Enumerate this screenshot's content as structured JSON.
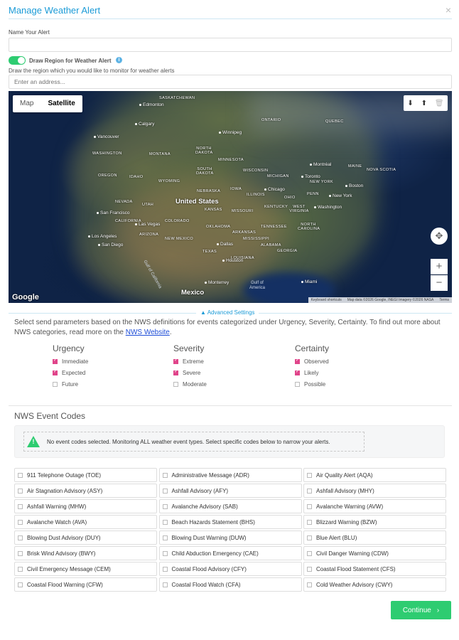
{
  "header": {
    "title": "Manage Weather Alert",
    "close_glyph": "×"
  },
  "name_field": {
    "label": "Name Your Alert",
    "value": "",
    "placeholder": ""
  },
  "region": {
    "toggle_on": true,
    "toggle_label": "Draw Region for Weather Alert",
    "info_glyph": "i",
    "help_text": "Draw the region which you would like to monitor for weather alerts",
    "address_placeholder": "Enter an address..."
  },
  "map": {
    "type_options": [
      "Map",
      "Satellite"
    ],
    "selected_type": "Satellite",
    "tools": {
      "download": "⬇",
      "upload": "⬆",
      "delete": "🗑"
    },
    "compass_glyph": "✥",
    "zoom_in": "+",
    "zoom_out": "−",
    "google_logo": "Google",
    "footer": [
      "Keyboard shortcuts",
      "Map data ©2026 Google, INEGI Imagery ©2026 NASA",
      "Terms"
    ],
    "labels": {
      "saskatchewan": "SASKATCHEWAN",
      "edmonton": "Edmonton",
      "calgary": "Calgary",
      "vancouver": "Vancouver",
      "winnipeg": "Winnipeg",
      "ontario": "ONTARIO",
      "quebec": "QUEBEC",
      "washington": "WASHINGTON",
      "montana": "MONTANA",
      "north_dakota": "NORTH DAKOTA",
      "minnesota": "MINNESOTA",
      "montreal": "Montréal",
      "maine": "MAINE",
      "oregon": "OREGON",
      "idaho": "IDAHO",
      "wyoming": "WYOMING",
      "south_dakota": "SOUTH DAKOTA",
      "wisconsin": "WISCONSIN",
      "michigan": "MICHIGAN",
      "toronto": "Toronto",
      "boston": "Boston",
      "nova_scotia": "NOVA SCOTIA",
      "new_york_state": "NEW YORK",
      "nevada": "NEVADA",
      "nebraska": "NEBRASKA",
      "iowa": "IOWA",
      "chicago": "Chicago",
      "ohio": "OHIO",
      "penn": "PENN",
      "new_york": "New York",
      "illinois": "ILLINOIS",
      "san_francisco": "San Francisco",
      "united_states": "United States",
      "utah": "UTAH",
      "kansas": "KANSAS",
      "missouri": "MISSOURI",
      "kentucky": "KENTUCKY",
      "west_virginia": "WEST VIRGINIA",
      "washington_dc": "Washington",
      "california": "CALIFORNIA",
      "las_vegas": "Las Vegas",
      "colorado": "COLORADO",
      "tennessee": "TENNESSEE",
      "north_carolina": "NORTH CAROLINA",
      "los_angeles": "Los Angeles",
      "arizona": "ARIZONA",
      "new_mexico": "NEW MEXICO",
      "oklahoma": "OKLAHOMA",
      "arkansas": "ARKANSAS",
      "mississippi": "MISSISSIPPI",
      "san_diego": "San Diego",
      "dallas": "Dallas",
      "alabama": "ALABAMA",
      "georgia": "GEORGIA",
      "texas": "TEXAS",
      "louisiana": "LOUISIANA",
      "houston": "Houston",
      "gulf": "Gulf of America",
      "monterrey": "Monterrey",
      "mexico": "Mexico",
      "miami": "Miami",
      "gulf_of_california": "Gulf of California"
    }
  },
  "advanced": {
    "toggle_label": "Advanced Settings",
    "toggle_glyph": "▲",
    "description_before": "Select send parameters based on the NWS definitions for events categorized under Urgency, Severity, Certainty. To find out more about NWS categories, read more on the ",
    "link_text": "NWS Website",
    "description_after": "."
  },
  "categories": [
    {
      "title": "Urgency",
      "options": [
        {
          "label": "Immediate",
          "checked": true
        },
        {
          "label": "Expected",
          "checked": true
        },
        {
          "label": "Future",
          "checked": false
        }
      ]
    },
    {
      "title": "Severity",
      "options": [
        {
          "label": "Extreme",
          "checked": true
        },
        {
          "label": "Severe",
          "checked": true
        },
        {
          "label": "Moderate",
          "checked": false
        }
      ]
    },
    {
      "title": "Certainty",
      "options": [
        {
          "label": "Observed",
          "checked": true
        },
        {
          "label": "Likely",
          "checked": true
        },
        {
          "label": "Possible",
          "checked": false
        }
      ]
    }
  ],
  "nws": {
    "title": "NWS Event Codes",
    "notice_glyph": "!",
    "notice": "No event codes selected. Monitoring ALL weather event types. Select specific codes below to narrow your alerts.",
    "codes": [
      "911 Telephone Outage (TOE)",
      "Administrative Message (ADR)",
      "Air Quality Alert (AQA)",
      "Air Stagnation Advisory (ASY)",
      "Ashfall Advisory (AFY)",
      "Ashfall Advisory (MHY)",
      "Ashfall Warning (MHW)",
      "Avalanche Advisory (SAB)",
      "Avalanche Warning (AVW)",
      "Avalanche Watch (AVA)",
      "Beach Hazards Statement (BHS)",
      "Blizzard Warning (BZW)",
      "Blowing Dust Advisory (DUY)",
      "Blowing Dust Warning (DUW)",
      "Blue Alert (BLU)",
      "Brisk Wind Advisory (BWY)",
      "Child Abduction Emergency (CAE)",
      "Civil Danger Warning (CDW)",
      "Civil Emergency Message (CEM)",
      "Coastal Flood Advisory (CFY)",
      "Coastal Flood Statement (CFS)",
      "Coastal Flood Warning (CFW)",
      "Coastal Flood Watch (CFA)",
      "Cold Weather Advisory (CWY)"
    ]
  },
  "footer": {
    "continue_label": "Continue",
    "continue_glyph": "›"
  }
}
